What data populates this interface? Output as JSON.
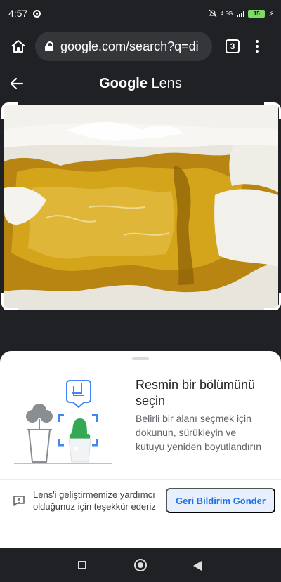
{
  "status_bar": {
    "time": "4:57",
    "network": "4.5G",
    "battery": "15",
    "icons": [
      "chrome-icon",
      "mute-icon",
      "signal-icon",
      "battery-icon",
      "charging-icon"
    ]
  },
  "browser": {
    "url": "google.com/search?q=di",
    "tab_count": "3",
    "icons": [
      "home-icon",
      "lock-icon",
      "tabs-icon",
      "menu-icon"
    ]
  },
  "lens": {
    "title_bold": "Google",
    "title_light": "Lens"
  },
  "sheet": {
    "title": "Resmin bir bölümünü seçin",
    "description": "Belirli bir alanı seçmek için dokunun, sürükleyin ve kutuyu yeniden boyutlandırın",
    "feedback_text": "Lens'i geliştirmemize yardımcı olduğunuz için teşekkür ederiz",
    "feedback_button": "Geri Bildirim Gönder"
  },
  "colors": {
    "toolbar": "#202124",
    "accent": "#1a73e8",
    "feedback_button_bg": "#e8f0fe",
    "battery": "#7ddc63",
    "photo_stain": "#c58f10"
  },
  "nav": {
    "icons": [
      "recent-apps-icon",
      "home-icon",
      "back-icon"
    ]
  }
}
